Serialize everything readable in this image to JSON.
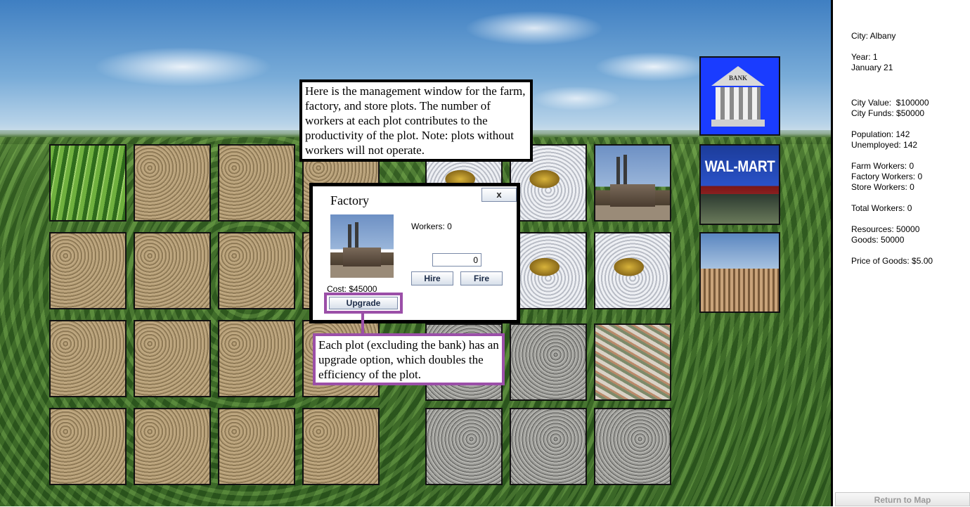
{
  "tutorial": {
    "management_text": "Here is the management window for the farm, factory, and store plots. The number of workers at each plot contributes to the productivity of the plot. Note: plots without workers will not operate.",
    "upgrade_text": "Each plot (excluding the bank) has an upgrade option, which doubles the efficiency of the plot."
  },
  "dialog": {
    "title": "Factory",
    "close_label": "x",
    "workers_text": "Workers: 0",
    "worker_input_value": "0",
    "hire_label": "Hire",
    "fire_label": "Fire",
    "cost_text": "Cost: $45000",
    "upgrade_label": "Upgrade"
  },
  "special_plots": {
    "bank_label": "BANK",
    "store_label": "WAL-MART"
  },
  "sidebar": {
    "city": "City: Albany",
    "year": "Year: 1",
    "date": "January 21",
    "city_value": "City Value:  $100000",
    "city_funds": "City Funds: $50000",
    "population": "Population: 142",
    "unemployed": "Unemployed: 142",
    "farm_workers": "Farm Workers: 0",
    "factory_workers": "Factory Workers: 0",
    "store_workers": "Store Workers: 0",
    "total_workers": "Total Workers: 0",
    "resources": "Resources: 50000",
    "goods": "Goods: 50000",
    "price_of_goods": "Price of Goods: $5.00",
    "return_label": "Return to Map"
  },
  "colors": {
    "callout_highlight": "#9b4fa8",
    "bank_bg": "#1a3cff"
  }
}
